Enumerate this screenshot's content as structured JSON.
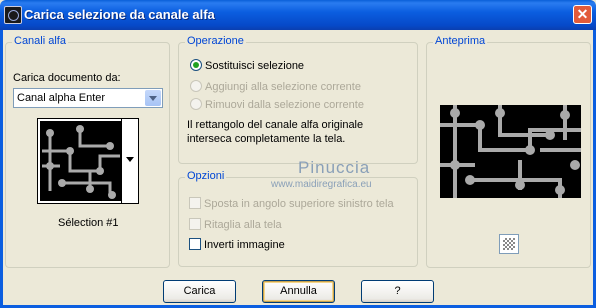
{
  "window": {
    "title": "Carica selezione da canale alfa",
    "close_glyph": "✕"
  },
  "alpha_channels": {
    "legend": "Canali alfa",
    "load_label": "Carica documento da:",
    "document_value": "Canal alpha Enter",
    "selection_name": "Sélection #1"
  },
  "operation": {
    "legend": "Operazione",
    "options": [
      {
        "label": "Sostituisci selezione",
        "selected": true,
        "enabled": true
      },
      {
        "label": "Aggiungi alla selezione corrente",
        "selected": false,
        "enabled": false
      },
      {
        "label": "Rimuovi dalla selezione corrente",
        "selected": false,
        "enabled": false
      }
    ],
    "description_line1": "Il rettangolo del canale alfa originale",
    "description_line2": "interseca completamente la tela."
  },
  "options": {
    "legend": "Opzioni",
    "items": [
      {
        "label": "Sposta in angolo superiore sinistro tela",
        "checked": false,
        "enabled": false
      },
      {
        "label": "Ritaglia alla tela",
        "checked": false,
        "enabled": false
      },
      {
        "label": "Inverti immagine",
        "checked": false,
        "enabled": true
      }
    ]
  },
  "preview": {
    "legend": "Anteprima",
    "icon": "checkerboard-icon"
  },
  "watermark": {
    "line1": "Pinuccia",
    "line2": "www.maidiregrafica.eu"
  },
  "buttons": {
    "ok": "Carica",
    "cancel": "Annulla",
    "help": "?"
  },
  "colors": {
    "titlebar": "#0b5ee0",
    "legend": "#0046d5",
    "dialog_bg": "#ece9d8",
    "radio_dot": "#21a121"
  }
}
